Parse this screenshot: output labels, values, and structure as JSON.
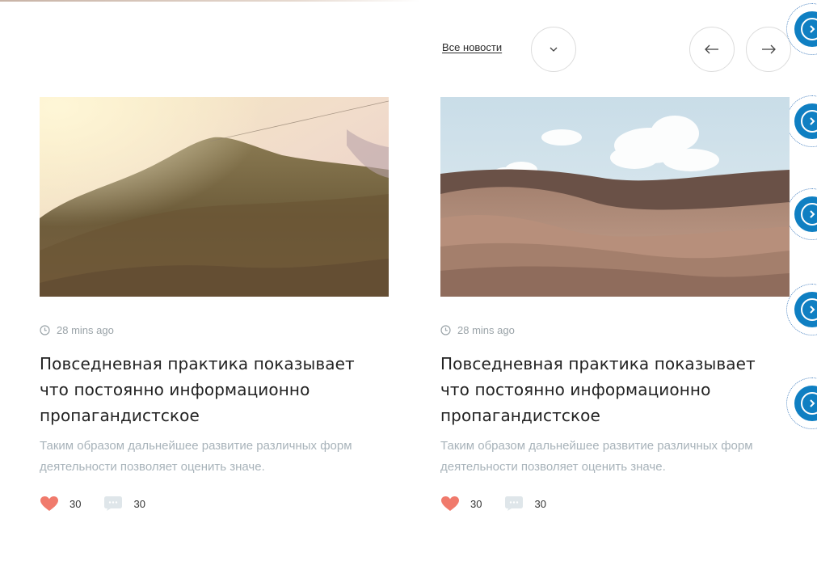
{
  "header": {
    "all_news_label": "Все новости"
  },
  "icons": {
    "dropdown": "chevron-down-icon",
    "prev": "arrow-left-icon",
    "next": "arrow-right-icon",
    "side": "chevron-right-circle-icon",
    "time": "clock-icon",
    "likes": "heart-icon",
    "comments": "comment-icon"
  },
  "colors": {
    "accent_blue": "#0f7fc2",
    "heart": "#f07a6c",
    "muted_text": "#a8b3ba"
  },
  "cards": [
    {
      "image": "forest-mountain-photo",
      "time": "28 mins ago",
      "title": "Повседневная практика показывает что постоянно информационно пропагандистское",
      "excerpt": "Таким образом дальнейшее развитие различных форм деятельности позволяет оценить значе.",
      "likes": "30",
      "comments": "30"
    },
    {
      "image": "desert-dunes-photo",
      "time": "28 mins ago",
      "title": "Повседневная практика показывает что постоянно информационно пропагандистское",
      "excerpt": "Таким образом дальнейшее развитие различных форм деятельности позволяет оценить значе.",
      "likes": "30",
      "comments": "30"
    }
  ]
}
